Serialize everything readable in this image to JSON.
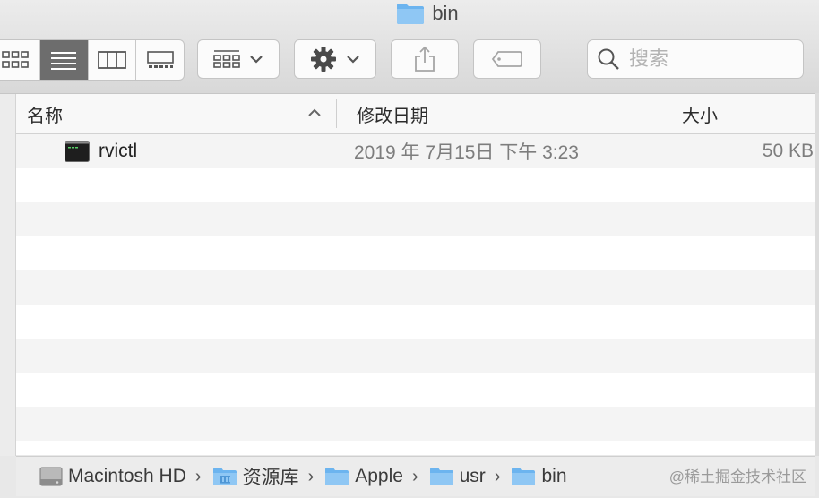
{
  "window": {
    "title": "bin"
  },
  "toolbar": {
    "view_modes": [
      "icon-view",
      "list-view",
      "column-view",
      "gallery-view"
    ],
    "active_view": "list-view",
    "search_placeholder": "搜索"
  },
  "columns": {
    "name": "名称",
    "modified": "修改日期",
    "size": "大小"
  },
  "files": [
    {
      "name": "rvictl",
      "modified": "2019 年 7月15日 下午 3:23",
      "size": "50 KB",
      "icon": "terminal-exec-icon"
    }
  ],
  "path": [
    {
      "label": "Macintosh HD",
      "icon": "hard-drive-icon"
    },
    {
      "label": "资源库",
      "icon": "library-folder-icon"
    },
    {
      "label": "Apple",
      "icon": "folder-icon"
    },
    {
      "label": "usr",
      "icon": "folder-icon"
    },
    {
      "label": "bin",
      "icon": "folder-icon"
    }
  ],
  "watermark": "@稀土掘金技术社区",
  "colors": {
    "folder": "#6cb4ef",
    "active_segment": "#6d6d6d",
    "row_alt": "#f4f4f4"
  }
}
